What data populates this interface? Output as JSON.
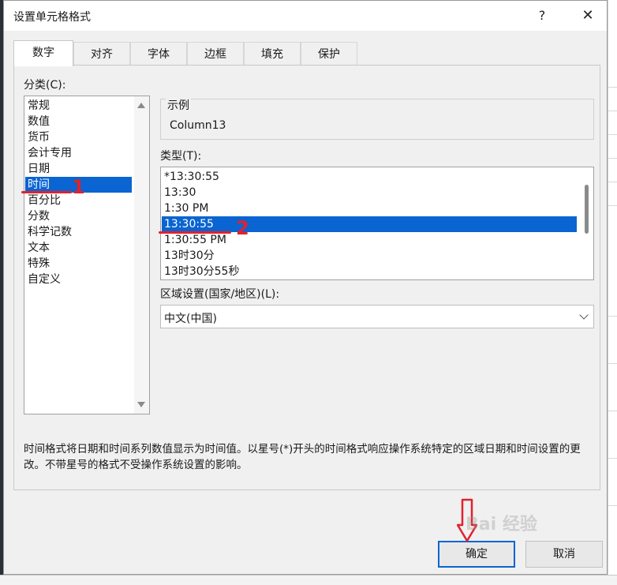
{
  "dialog": {
    "title": "设置单元格格式",
    "help_glyph": "?",
    "close_glyph": "✕"
  },
  "tabs": [
    "数字",
    "对齐",
    "字体",
    "边框",
    "填充",
    "保护"
  ],
  "active_tab": "数字",
  "category": {
    "label": "分类(C):",
    "items": [
      "常规",
      "数值",
      "货币",
      "会计专用",
      "日期",
      "时间",
      "百分比",
      "分数",
      "科学记数",
      "文本",
      "特殊",
      "自定义"
    ],
    "selected": "时间"
  },
  "sample": {
    "legend": "示例",
    "value": "Column13"
  },
  "type": {
    "label": "类型(T):",
    "items": [
      "*13:30:55",
      "13:30",
      "1:30 PM",
      "13:30:55",
      "1:30:55 PM",
      "13时30分",
      "13时30分55秒"
    ],
    "selected_index": 3
  },
  "locale": {
    "label": "区域设置(国家/地区)(L):",
    "value": "中文(中国)"
  },
  "description": "时间格式将日期和时间系列数值显示为时间值。以星号(*)开头的时间格式响应操作系统特定的区域日期和时间设置的更改。不带星号的格式不受操作系统设置的影响。",
  "buttons": {
    "ok": "确定",
    "cancel": "取消"
  },
  "annotations": {
    "num1": "1",
    "num2": "2",
    "color": "#e0222d"
  },
  "watermark": "Bai 经验",
  "colors": {
    "selection": "#0a64d2",
    "dialog_bg": "#f0f0f0"
  }
}
